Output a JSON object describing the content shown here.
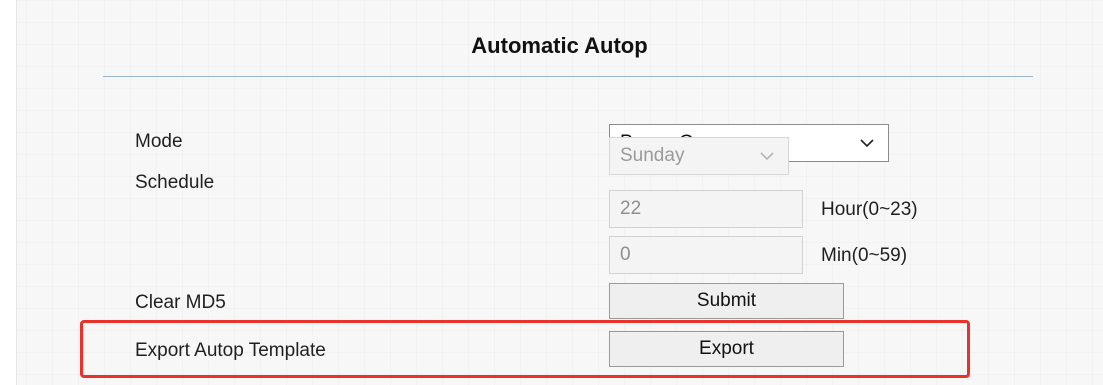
{
  "section": {
    "title": "Automatic Autop"
  },
  "form": {
    "mode": {
      "label": "Mode",
      "value": "Power On"
    },
    "schedule": {
      "label": "Schedule",
      "day": "Sunday"
    },
    "hour": {
      "value": "22",
      "unit": "Hour(0~23)"
    },
    "minute": {
      "value": "0",
      "unit": "Min(0~59)"
    },
    "clear_md5": {
      "label": "Clear MD5",
      "button": "Submit"
    },
    "export_template": {
      "label": "Export Autop Template",
      "button": "Export"
    }
  },
  "colors": {
    "highlight_border": "#e8322a",
    "divider": "#9bb7cf"
  },
  "icons": {
    "select_arrow": "chevron-down-icon"
  }
}
